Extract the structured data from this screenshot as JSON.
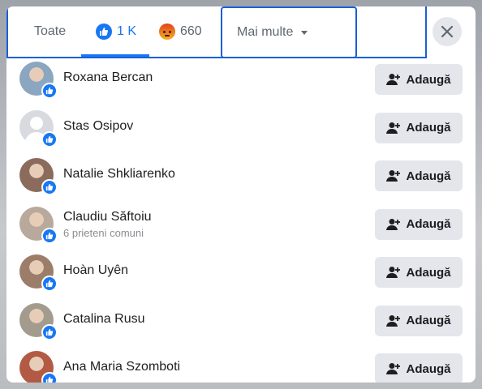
{
  "tabs": {
    "all": "Toate",
    "like_count": "1 K",
    "angry_count": "660",
    "more": "Mai multe"
  },
  "people": [
    {
      "name": "Roxana Bercan",
      "sub": "",
      "action": "Adaugă",
      "avatar": "photo"
    },
    {
      "name": "Stas Osipov",
      "sub": "",
      "action": "Adaugă",
      "avatar": "default"
    },
    {
      "name": "Natalie Shkliarenko",
      "sub": "",
      "action": "Adaugă",
      "avatar": "photo"
    },
    {
      "name": "Claudiu Săftoiu",
      "sub": "6 prieteni comuni",
      "action": "Adaugă",
      "avatar": "photo"
    },
    {
      "name": "Hoàn Uyên",
      "sub": "",
      "action": "Adaugă",
      "avatar": "photo"
    },
    {
      "name": "Catalina Rusu",
      "sub": "",
      "action": "Adaugă",
      "avatar": "photo"
    },
    {
      "name": "Ana Maria Szomboti",
      "sub": "",
      "action": "Adaugă",
      "avatar": "photo"
    }
  ],
  "colors": {
    "accent": "#1877f2",
    "button_bg": "#e4e6eb"
  }
}
